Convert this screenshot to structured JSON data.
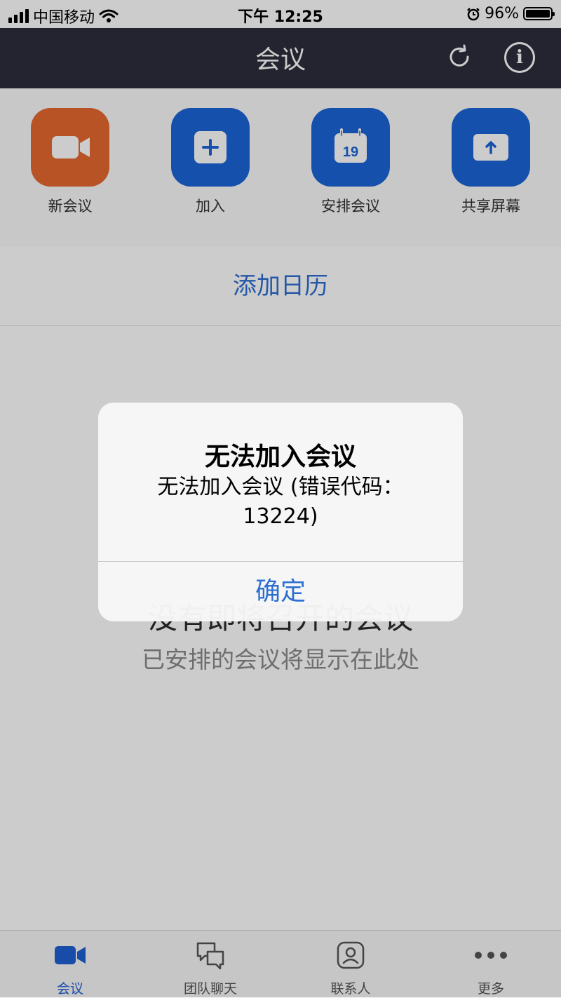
{
  "status_bar": {
    "carrier": "中国移动",
    "time": "下午 12:25",
    "battery": "96%"
  },
  "nav": {
    "title": "会议",
    "refresh_icon": "refresh-icon",
    "info_icon": "info-icon",
    "info_glyph": "i"
  },
  "actions": [
    {
      "label": "新会议",
      "icon": "video-camera-icon",
      "color": "#e5682d"
    },
    {
      "label": "加入",
      "icon": "plus-icon",
      "color": "#1a64d8"
    },
    {
      "label": "安排会议",
      "icon": "calendar-icon",
      "calendar_day": "19",
      "color": "#1a64d8"
    },
    {
      "label": "共享屏幕",
      "icon": "share-screen-icon",
      "color": "#1a64d8"
    }
  ],
  "add_calendar": "添加日历",
  "empty_state": {
    "title": "没有即将召开的会议",
    "subtitle": "已安排的会议将显示在此处"
  },
  "alert": {
    "title": "无法加入会议",
    "message": "无法加入会议 (错误代码：13224)",
    "button": "确定"
  },
  "tabs": [
    {
      "label": "会议",
      "icon": "video-camera-icon",
      "active": true
    },
    {
      "label": "团队聊天",
      "icon": "chat-bubbles-icon",
      "active": false
    },
    {
      "label": "联系人",
      "icon": "contact-icon",
      "active": false
    },
    {
      "label": "更多",
      "icon": "more-dots-icon",
      "active": false
    }
  ],
  "colors": {
    "accent_blue": "#1a64d8",
    "link_blue": "#2d6fd1",
    "orange": "#e5682d",
    "nav_bg": "#2d2e3c"
  }
}
